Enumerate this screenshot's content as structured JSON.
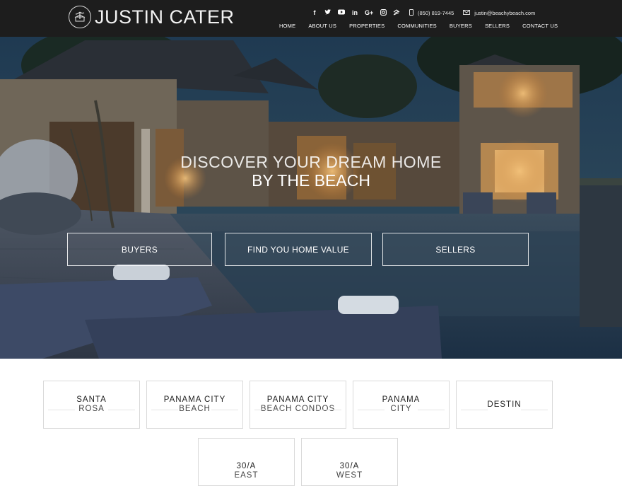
{
  "brand": {
    "name": "JUSTIN CATER"
  },
  "header": {
    "social_icons": [
      "facebook-icon",
      "twitter-icon",
      "youtube-icon",
      "linkedin-icon",
      "google-plus-icon",
      "instagram-icon",
      "zillow-icon"
    ],
    "phone": "(850) 819-7445",
    "email": "justin@beachybeach.com"
  },
  "nav": {
    "items": [
      "HOME",
      "ABOUT US",
      "PROPERTIES",
      "COMMUNITIES",
      "BUYERS",
      "SELLERS",
      "CONTACT US"
    ]
  },
  "hero": {
    "headline_1": "DISCOVER YOUR DREAM HOME",
    "headline_2": "BY THE BEACH",
    "buttons": [
      "BUYERS",
      "FIND YOU HOME VALUE",
      "SELLERS"
    ]
  },
  "communities": [
    {
      "line1": "SANTA",
      "line2": "ROSA"
    },
    {
      "line1": "PANAMA CITY",
      "line2": "BEACH"
    },
    {
      "line1": "PANAMA CITY",
      "line2": "BEACH CONDOS"
    },
    {
      "line1": "PANAMA",
      "line2": "CITY"
    },
    {
      "line1": "DESTIN",
      "line2": ""
    },
    {
      "line1": "30/A",
      "line2": "EAST"
    },
    {
      "line1": "30/A",
      "line2": "WEST"
    }
  ],
  "colors": {
    "header_bg": "#1d1d1d",
    "card_border": "#d9d9d9",
    "text_dark": "#222222"
  }
}
